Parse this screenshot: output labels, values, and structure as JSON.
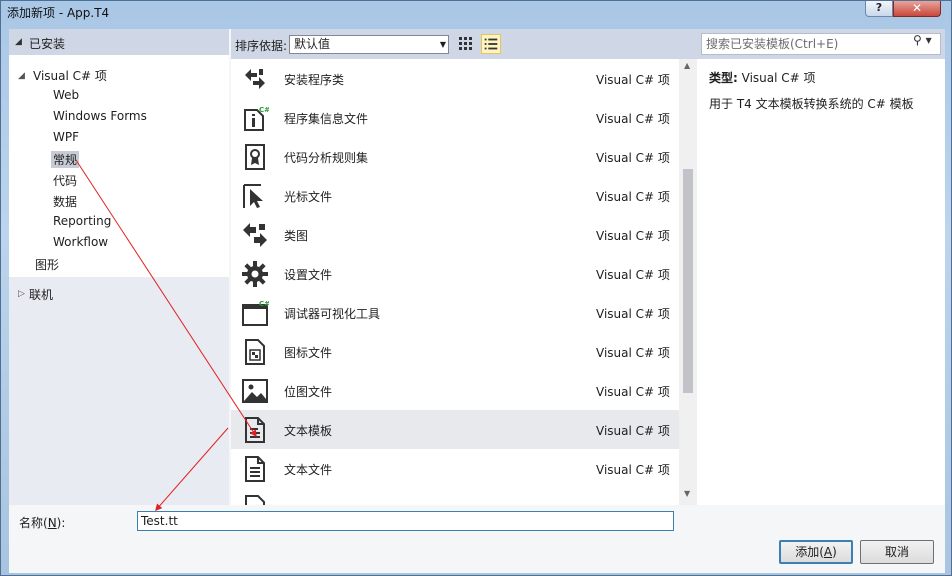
{
  "window": {
    "title": "添加新项 - App.T4",
    "help_label": "?",
    "close_label": "✕"
  },
  "left": {
    "installed_label": "已安装",
    "tree": [
      {
        "label": "Visual C# 项"
      },
      {
        "label": "Web"
      },
      {
        "label": "Windows Forms"
      },
      {
        "label": "WPF"
      },
      {
        "label": "常规"
      },
      {
        "label": "代码"
      },
      {
        "label": "数据"
      },
      {
        "label": "Reporting"
      },
      {
        "label": "Workflow"
      },
      {
        "label": "图形"
      }
    ],
    "online_label": "联机"
  },
  "sort": {
    "label": "排序依据:",
    "selected": "默认值"
  },
  "search": {
    "placeholder": "搜索已安装模板(Ctrl+E)"
  },
  "templates": [
    {
      "name": "安装程序类",
      "type": "Visual C# 项",
      "icon": "installer-class-icon"
    },
    {
      "name": "程序集信息文件",
      "type": "Visual C# 项",
      "icon": "assembly-info-icon"
    },
    {
      "name": "代码分析规则集",
      "type": "Visual C# 项",
      "icon": "code-analysis-ruleset-icon"
    },
    {
      "name": "光标文件",
      "type": "Visual C# 项",
      "icon": "cursor-file-icon"
    },
    {
      "name": "类图",
      "type": "Visual C# 项",
      "icon": "class-diagram-icon"
    },
    {
      "name": "设置文件",
      "type": "Visual C# 项",
      "icon": "settings-gear-icon"
    },
    {
      "name": "调试器可视化工具",
      "type": "Visual C# 项",
      "icon": "debugger-visualizer-icon"
    },
    {
      "name": "图标文件",
      "type": "Visual C# 项",
      "icon": "icon-file-icon"
    },
    {
      "name": "位图文件",
      "type": "Visual C# 项",
      "icon": "bitmap-file-icon"
    },
    {
      "name": "文本模板",
      "type": "Visual C# 项",
      "icon": "text-template-icon",
      "selected": true
    },
    {
      "name": "文本文件",
      "type": "Visual C# 项",
      "icon": "text-file-icon"
    }
  ],
  "details": {
    "type_label": "类型:",
    "type_value": "Visual C# 项",
    "description": "用于 T4 文本模板转换系统的 C# 模板"
  },
  "bottom": {
    "name_label_prefix": "名称(",
    "name_label_key": "N",
    "name_label_suffix": "):",
    "name_value": "Test.tt",
    "add_prefix": "添加(",
    "add_key": "A",
    "add_suffix": ")",
    "cancel_label": "取消"
  },
  "colors": {
    "annotation_arrow": "#e02020",
    "selection_border": "#3c7fb1"
  }
}
